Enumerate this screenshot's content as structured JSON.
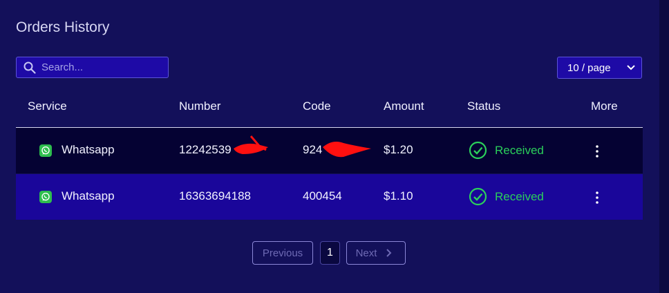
{
  "page": {
    "title": "Orders History"
  },
  "search": {
    "placeholder": "Search..."
  },
  "page_size": {
    "selected": "10 / page"
  },
  "table": {
    "columns": [
      "Service",
      "Number",
      "Code",
      "Amount",
      "Status",
      "More"
    ],
    "rows": [
      {
        "service": "Whatsapp",
        "number": "12242539",
        "code": "924",
        "amount": "$1.20",
        "status": "Received"
      },
      {
        "service": "Whatsapp",
        "number": "16363694188",
        "code": "400454",
        "amount": "$1.10",
        "status": "Received"
      }
    ]
  },
  "pagination": {
    "previous": "Previous",
    "current": "1",
    "next": "Next"
  },
  "colors": {
    "background": "#13105a",
    "accent": "#1e0aa6",
    "success": "#2bd05b",
    "whatsapp": "#2ebd4e"
  },
  "icons": [
    "search-icon",
    "chevron-down-icon",
    "whatsapp-icon",
    "check-circle-icon",
    "more-vertical-icon",
    "chevron-right-icon"
  ]
}
